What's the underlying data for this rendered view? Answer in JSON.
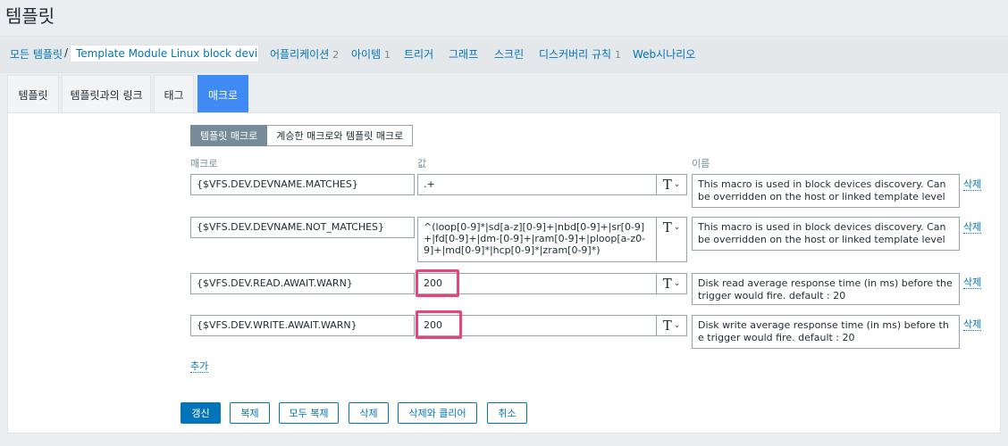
{
  "page": {
    "title": "템플릿"
  },
  "breadcrumb": {
    "all_templates": "모든 템플릿",
    "separator": "/",
    "current": "Template Module Linux block devic...",
    "links": [
      {
        "label": "어플리케이션",
        "count": "2"
      },
      {
        "label": "아이템",
        "count": "1"
      },
      {
        "label": "트리거",
        "count": ""
      },
      {
        "label": "그래프",
        "count": ""
      },
      {
        "label": "스크린",
        "count": ""
      },
      {
        "label": "디스커버리 규칙",
        "count": "1"
      },
      {
        "label": "Web시나리오",
        "count": ""
      }
    ]
  },
  "tabs": [
    {
      "label": "템플릿",
      "active": false
    },
    {
      "label": "템플릿과의 링크",
      "active": false
    },
    {
      "label": "태그",
      "active": false
    },
    {
      "label": "매크로",
      "active": true
    }
  ],
  "macro_scope": {
    "template_macros": "템플릿 매크로",
    "inherited_macros": "계승한 매크로와 템플릿 매크로",
    "selected": "템플릿 매크로"
  },
  "columns": {
    "macro": "매크로",
    "value": "값",
    "description": "이름"
  },
  "macros": [
    {
      "macro": "{$VFS.DEV.DEVNAME.MATCHES}",
      "value": ".+",
      "type_icon": "T",
      "description": "This macro is used in block devices discovery. Can be overridden on the host or linked template level",
      "remove": "삭제",
      "highlighted": false
    },
    {
      "macro": "{$VFS.DEV.DEVNAME.NOT_MATCHES}",
      "value": "^(loop[0-9]*|sd[a-z][0-9]+|nbd[0-9]+|sr[0-9]+|fd[0-9]+|dm-[0-9]+|ram[0-9]+|ploop[a-z0-9]+|md[0-9]*|hcp[0-9]*|zram[0-9]*)",
      "type_icon": "T",
      "description": "This macro is used in block devices discovery. Can be overridden on the host or linked template level",
      "remove": "삭제",
      "highlighted": false
    },
    {
      "macro": "{$VFS.DEV.READ.AWAIT.WARN}",
      "value": "200",
      "type_icon": "T",
      "description": "Disk read average response time (in ms) before the trigger would fire. default : 20",
      "remove": "삭제",
      "highlighted": true
    },
    {
      "macro": "{$VFS.DEV.WRITE.AWAIT.WARN}",
      "value": "200",
      "type_icon": "T",
      "description": "Disk write average response time (in ms) before the trigger would fire. default : 20",
      "remove": "삭제",
      "highlighted": true
    }
  ],
  "add_label": "추가",
  "actions": {
    "update": "갱신",
    "clone": "복제",
    "full_clone": "모두 복제",
    "delete": "삭제",
    "delete_and_clear": "삭제와 클리어",
    "cancel": "취소"
  },
  "colors": {
    "accent": "#0275b8",
    "active_tab": "#3f8af3",
    "highlight": "#e8447a",
    "segment_on": "#768d99"
  }
}
